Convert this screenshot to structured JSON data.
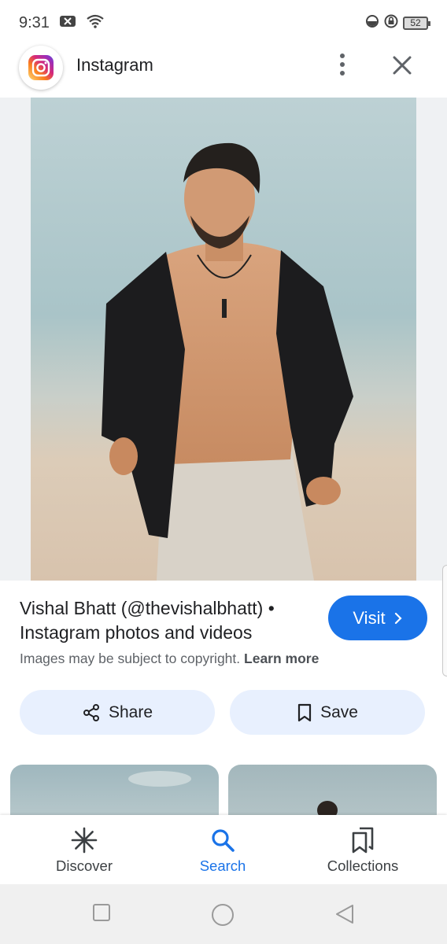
{
  "status_bar": {
    "time": "9:31",
    "battery": "52"
  },
  "app_bar": {
    "title": "Instagram",
    "logo_icon": "instagram-logo",
    "more_icon": "more-vert-icon",
    "close_icon": "close-icon"
  },
  "result": {
    "title": "Vishal Bhatt (@thevishalbhatt) • Instagram photos and videos",
    "visit_label": "Visit",
    "copyright_text": "Images may be subject to copyright.",
    "learn_more": "Learn more",
    "share_label": "Share",
    "save_label": "Save"
  },
  "bottom_nav": {
    "items": [
      {
        "label": "Discover",
        "icon": "asterisk-icon"
      },
      {
        "label": "Search",
        "icon": "search-icon",
        "active": true
      },
      {
        "label": "Collections",
        "icon": "collections-icon"
      }
    ]
  },
  "colors": {
    "accent": "#1a73e8",
    "pill_bg": "#e8f0fe",
    "viewer_bg": "#eff1f3"
  }
}
